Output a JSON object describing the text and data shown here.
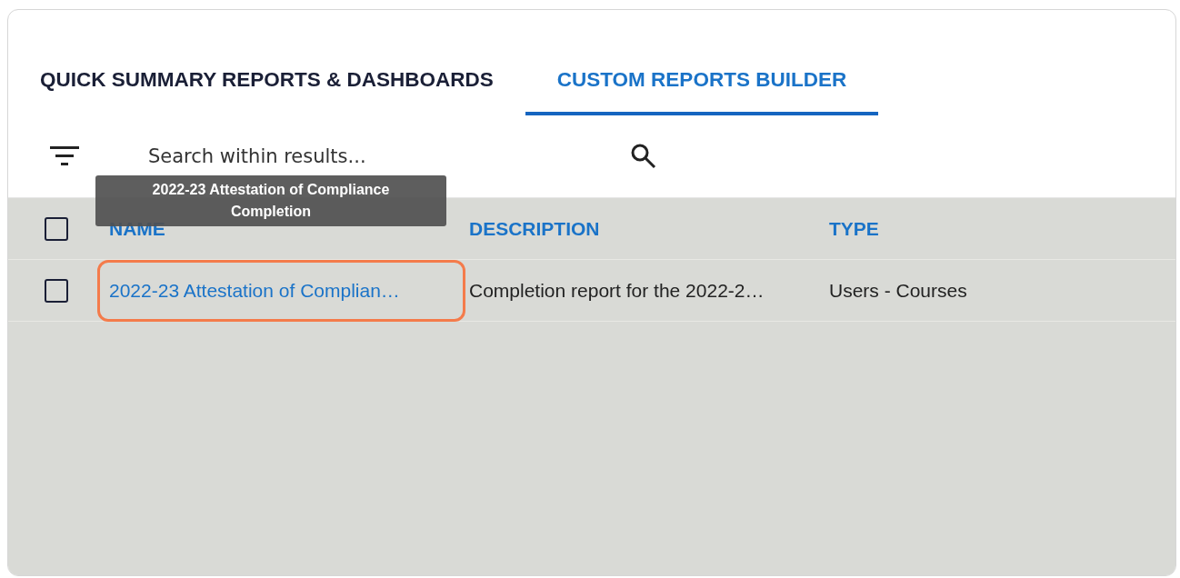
{
  "tabs": [
    {
      "label": "QUICK SUMMARY REPORTS & DASHBOARDS",
      "selected": false
    },
    {
      "label": "CUSTOM REPORTS BUILDER",
      "selected": true
    }
  ],
  "search": {
    "placeholder": "Search within results..."
  },
  "table": {
    "header_checked": false,
    "columns": [
      "NAME",
      "DESCRIPTION",
      "TYPE"
    ],
    "rows": [
      {
        "checked": false,
        "highlighted": true,
        "cells": [
          "2022-23 Attestation of Complian…",
          "Completion report for the 2022-2…",
          "Users - Courses"
        ]
      }
    ]
  },
  "tooltip": {
    "text": "2022-23 Attestation of Compliance Completion"
  }
}
